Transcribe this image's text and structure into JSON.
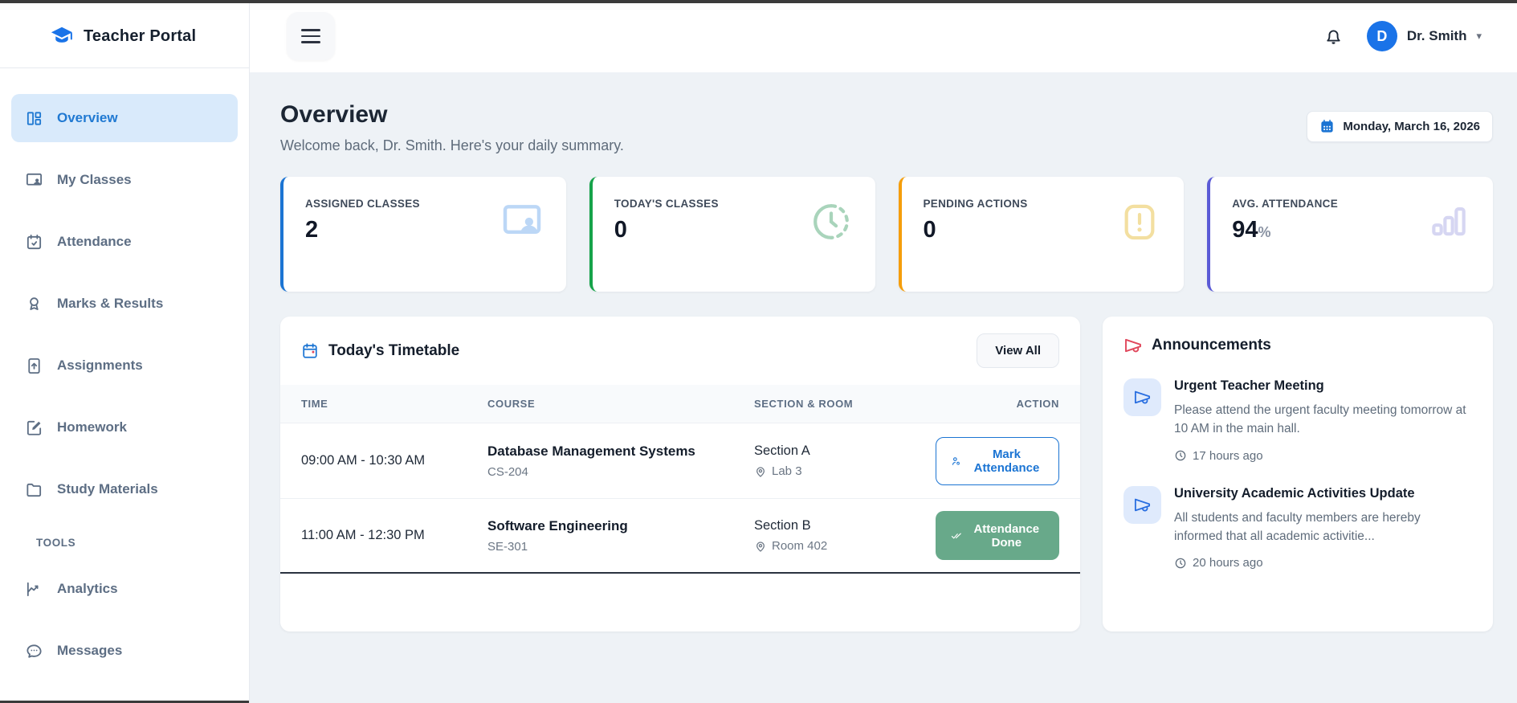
{
  "app": {
    "title": "Teacher Portal"
  },
  "topbar": {
    "avatar_initial": "D",
    "user_name": "Dr. Smith"
  },
  "sidebar": {
    "items": [
      {
        "label": "Overview",
        "icon": "grid-layout-icon",
        "active": true
      },
      {
        "label": "My Classes",
        "icon": "classroom-board-icon",
        "active": false
      },
      {
        "label": "Attendance",
        "icon": "calendar-check-icon",
        "active": false
      },
      {
        "label": "Marks & Results",
        "icon": "award-icon",
        "active": false
      },
      {
        "label": "Assignments",
        "icon": "file-upload-icon",
        "active": false
      },
      {
        "label": "Homework",
        "icon": "pencil-square-icon",
        "active": false
      },
      {
        "label": "Study Materials",
        "icon": "folder-icon",
        "active": false
      }
    ],
    "tools_label": "TOOLS",
    "tools_items": [
      {
        "label": "Analytics",
        "icon": "chart-line-icon"
      },
      {
        "label": "Messages",
        "icon": "chat-bubble-icon"
      }
    ]
  },
  "header": {
    "title": "Overview",
    "subtitle": "Welcome back, Dr. Smith. Here's your daily summary.",
    "date": "Monday, March 16, 2026"
  },
  "stats": [
    {
      "label": "ASSIGNED CLASSES",
      "value": "2",
      "icon": "classroom-board-icon",
      "accent": "#1b74d3"
    },
    {
      "label": "TODAY'S CLASSES",
      "value": "0",
      "icon": "clock-icon",
      "accent": "#16a34a"
    },
    {
      "label": "PENDING ACTIONS",
      "value": "0",
      "icon": "alert-icon",
      "accent": "#f59e0b"
    },
    {
      "label": "AVG. ATTENDANCE",
      "value": "94",
      "suffix": "%",
      "icon": "bar-chart-icon",
      "accent": "#5b5bd6"
    }
  ],
  "timetable": {
    "title": "Today's Timetable",
    "view_all_label": "View All",
    "columns": [
      "TIME",
      "COURSE",
      "SECTION & ROOM",
      "ACTION"
    ],
    "rows": [
      {
        "time": "09:00 AM - 10:30 AM",
        "course": "Database Management Systems",
        "code": "CS-204",
        "section": "Section A",
        "room": "Lab 3",
        "action_label": "Mark Attendance",
        "action_state": "pending"
      },
      {
        "time": "11:00 AM - 12:30 PM",
        "course": "Software Engineering",
        "code": "SE-301",
        "section": "Section B",
        "room": "Room 402",
        "action_label": "Attendance Done",
        "action_state": "done"
      }
    ]
  },
  "announcements": {
    "title": "Announcements",
    "items": [
      {
        "title": "Urgent Teacher Meeting",
        "body": "Please attend the urgent faculty meeting tomorrow at 10 AM in the main hall.",
        "time": "17 hours ago"
      },
      {
        "title": "University Academic Activities Update",
        "body": "All students and faculty members are hereby informed that all academic activitie...",
        "time": "20 hours ago"
      }
    ]
  },
  "colors": {
    "primary_blue": "#1b74d3",
    "brand_blue": "#1a73e8",
    "active_nav_bg": "#d9eafb",
    "green_accent": "#16a34a",
    "orange_accent": "#f59e0b",
    "indigo_accent": "#5b5bd6",
    "done_button_green": "#68a98a",
    "announce_red": "#e0475c",
    "main_background": "#eef2f6"
  }
}
